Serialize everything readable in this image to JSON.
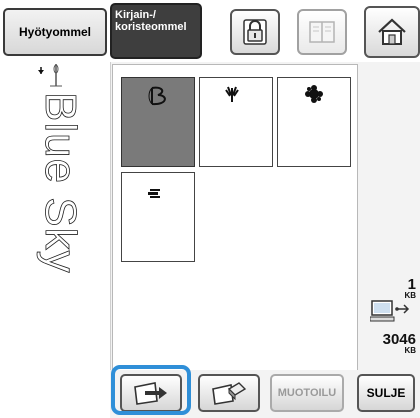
{
  "header": {
    "tabs": [
      {
        "label": "Hyötyommel",
        "active": false
      },
      {
        "label_line1": "Kirjain-/",
        "label_line2": "koristeommel",
        "active": true
      }
    ],
    "icons": [
      "lock-icon",
      "book-icon",
      "home-icon"
    ]
  },
  "preview": {
    "text": "Blue Sky",
    "needle_icon": "needle-icon"
  },
  "patterns": [
    {
      "icon": "letter-b-stitch",
      "selected": true
    },
    {
      "icon": "hand-stitch",
      "selected": false
    },
    {
      "icon": "flower-stitch",
      "selected": false
    },
    {
      "icon": "bead-stitch",
      "selected": false
    }
  ],
  "info": {
    "pattern_size": "1",
    "pattern_size_unit": "KB",
    "memory_icon": "computer-usb-icon",
    "memory_free": "3046",
    "memory_unit": "KB"
  },
  "footer": {
    "save_icon": "save-to-device-icon",
    "erase_icon": "eraser-icon",
    "edit_label": "MUOTOILU",
    "close_label": "SULJE"
  },
  "colors": {
    "highlight": "#2f8fd8",
    "active_tab": "#3e3e3e",
    "selected_tile": "#7a7a7a"
  }
}
